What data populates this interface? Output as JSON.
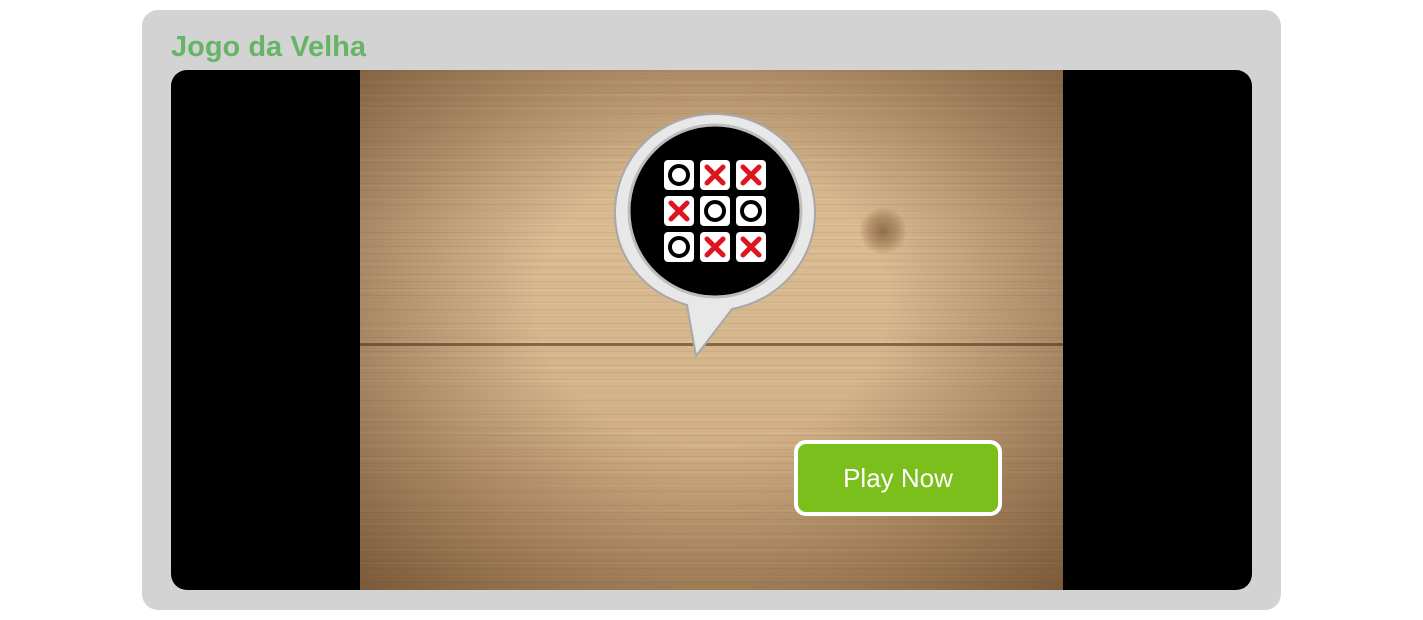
{
  "widget": {
    "title": "Jogo da Velha",
    "title_color": "#66b566",
    "background_color": "#d3d3d3"
  },
  "stage": {
    "background_color": "#000000",
    "board_texture": "wooden-planks"
  },
  "logo": {
    "icon": "tic-tac-toe-speech-bubble-icon",
    "grid": [
      [
        "O",
        "X",
        "X"
      ],
      [
        "X",
        "O",
        "O"
      ],
      [
        "O",
        "X",
        "X"
      ]
    ],
    "x_color": "#e0141e",
    "o_color": "#000000"
  },
  "play_button": {
    "label": "Play Now",
    "color": "#7abf1b"
  }
}
